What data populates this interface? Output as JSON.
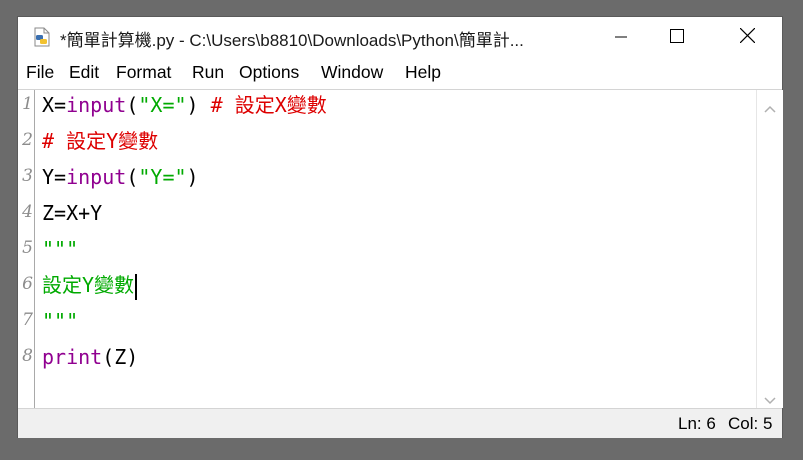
{
  "window": {
    "title": "*簡單計算機.py - C:\\Users\\b8810\\Downloads\\Python\\簡單計..."
  },
  "menu": [
    "File",
    "Edit",
    "Format",
    "Run",
    "Options",
    "Window",
    "Help"
  ],
  "editor": {
    "line_numbers": [
      "1",
      "2",
      "3",
      "4",
      "5",
      "6",
      "7",
      "8"
    ],
    "lines": [
      [
        {
          "t": "X=",
          "c": "plain"
        },
        {
          "t": "input",
          "c": "kw"
        },
        {
          "t": "(",
          "c": "plain"
        },
        {
          "t": "\"X=\"",
          "c": "str"
        },
        {
          "t": ") ",
          "c": "plain"
        },
        {
          "t": "# 設定X變數",
          "c": "cmt"
        }
      ],
      [
        {
          "t": "# 設定Y變數",
          "c": "cmt"
        }
      ],
      [
        {
          "t": "Y=",
          "c": "plain"
        },
        {
          "t": "input",
          "c": "kw"
        },
        {
          "t": "(",
          "c": "plain"
        },
        {
          "t": "\"Y=\"",
          "c": "str"
        },
        {
          "t": ")",
          "c": "plain"
        }
      ],
      [
        {
          "t": "Z=X+Y",
          "c": "plain"
        }
      ],
      [
        {
          "t": "\"\"\"",
          "c": "str"
        }
      ],
      [
        {
          "t": "設定Y變數",
          "c": "str"
        }
      ],
      [
        {
          "t": "\"\"\"",
          "c": "str"
        }
      ],
      [
        {
          "t": "print",
          "c": "kw"
        },
        {
          "t": "(Z)",
          "c": "plain"
        }
      ]
    ],
    "caret_line": 6
  },
  "status": {
    "ln": "Ln: 6",
    "col": "Col: 5"
  },
  "icons": {
    "app": "python-file-icon",
    "minimize": "minimize-icon",
    "maximize": "maximize-icon",
    "close": "close-icon",
    "scroll_up": "chevron-up-icon",
    "scroll_down": "chevron-down-icon"
  },
  "colors": {
    "keyword": "#900090",
    "string": "#00aa00",
    "comment": "#dd0000",
    "text": "#000000"
  }
}
